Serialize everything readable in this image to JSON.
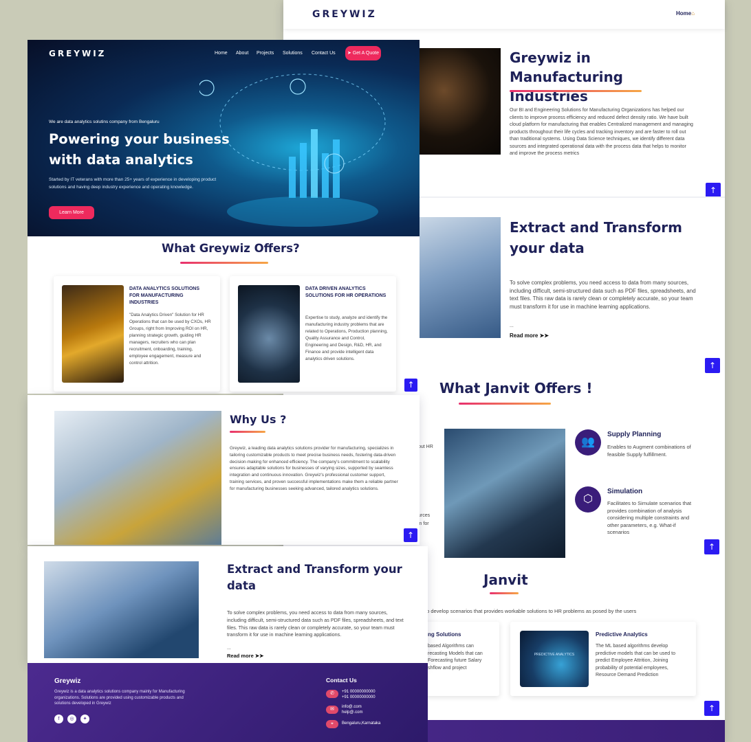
{
  "back": {
    "logo": "GREYWIZ",
    "nav_home": "Home",
    "manufacturing": {
      "title": "Greywiz in Manufacturing Industries",
      "body": "Our BI and Engineering Solutions for Manufacturing Organizations has helped our clients to improve process efficiency and reduced defect density ratio. We have built cloud platform for manufacturing that enables Centralized management and managing products throughout their life cycles and tracking inventory and are faster to roll out than traditional systems. Using Data Science techniques, we identify different data sources and integrated operational data with the process data that helps to monitor and improve the process metrics"
    },
    "extract": {
      "title": "Extract and Transform your data",
      "body": "To solve complex problems, you need access to data from many sources, including difficult, semi-structured data such as PDF files, spreadsheets, and text files. This raw data is rarely clean or completely accurate, so your team must transform it for use in machine learning applications.",
      "ellipsis": "...",
      "read_more": "Read more ➤➤"
    },
    "janvit_offers": {
      "title": "What Janvit Offers !",
      "cut_left_1": "out HR",
      "cut_left_2": "urces",
      "cut_left_3": "in for",
      "features": [
        {
          "icon": "👥",
          "title": "Supply Planning",
          "body": "Enables to Augment combinations of feasible Supply fulfillment."
        },
        {
          "icon": "⬡",
          "title": "Simulation",
          "body": "Facilitates to Simulate scenarios that provides combination of analysis considering multiple constraints and other parameters, e.g. What-if scenarios"
        }
      ]
    },
    "janvit": {
      "title": "Janvit",
      "subtitle": "es to develop scenarios that provides workable solutions to HR problems as posed by the users",
      "left_card_title": "ng Solutions",
      "left_card_body": "based Algorithms can\nrecasting Models that can\n Forecasting future Salary\nshflow and project",
      "card_title": "Predictive Analytics",
      "card_body": "The ML based algorithms develop predictive models that can be used to predict Employee Attrition, Joining probability of potential employees, Resource Demand Prediction",
      "card_img_text": "PREDICTIVE ANALYTICS"
    },
    "up_arrow": "↑"
  },
  "front": {
    "logo": "GREYWIZ",
    "nav": [
      "Home",
      "About",
      "Projects",
      "Solutions",
      "Contact Us"
    ],
    "cta": "➤ Get A Quote",
    "hero_kicker": "We are data analytics solutins company from Bengaluru",
    "hero_title_1": "Powering your business",
    "hero_title_2": "with data analytics",
    "hero_body": "Started by IT veterans with more than 25+ years of experience in developing product solutions and having deep industry experience and operating knowledge.",
    "learn_more": "Learn More",
    "offers_title": "What Greywiz Offers?",
    "offers": [
      {
        "title": "DATA ANALYTICS SOLUTIONS FOR MANUFACTURING INDUSTRIES",
        "body": "\"Data Analytics Driven\" Solution for HR Operations that can be used by CXOs, HR Groups, right from Improving ROI on HR, planning strategic growth, guiding HR managers, recruiters who can plan recruitment, onboarding, training, employee engagement, measure and control attrition."
      },
      {
        "title": "DATA DRIVEN ANALYTICS SOLUTIONS FOR HR OPERATIONS",
        "body": "Expertise to study, analyze and identify the manufacturing industry problems that are related to Operations, Production planning, Quality Assurance and Control, Engineering and Design, R&D, HR, and Finance and provide intelligent data analytics driven solutions."
      }
    ],
    "why_title": "Why Us ?",
    "why_body": "Greywiz, a leading data analytics solutions provider for manufacturing, specializes in tailoring customizable products to meet precise business needs, fostering data-driven decision-making for enhanced efficiency. The company's commitment to scalability ensures adaptable solutions for businesses of varying sizes, supported by seamless integration and continuous innovation. Greywiz's professional customer support, training services, and proven successful implementations make them a reliable partner for manufacturing businesses seeking advanced, tailored analytics solutions.",
    "extract_title": "Extract and Transform your data",
    "extract_body": "To solve complex problems, you need access to data from many sources, including difficult, semi-structured data such as PDF files, spreadsheets, and text files. This raw data is rarely clean or completely accurate, so your team must transform it for use in machine learning applications.",
    "extract_ellipsis": "...",
    "read_more": "Read more ➤➤",
    "footer": {
      "brand": "Greywiz",
      "about": "Greywiz is a data analytics solutions company mainly for Manufacturing organizations. Solutions are provided using customizable products and solutions developed in Greywiz",
      "contact_title": "Contact Us",
      "phone_1": "+91 00000000000",
      "phone_2": "+91 00000000000",
      "email_1": "info@.com",
      "email_2": "help@.com",
      "location": "Bengaluru,Karnataka"
    }
  }
}
